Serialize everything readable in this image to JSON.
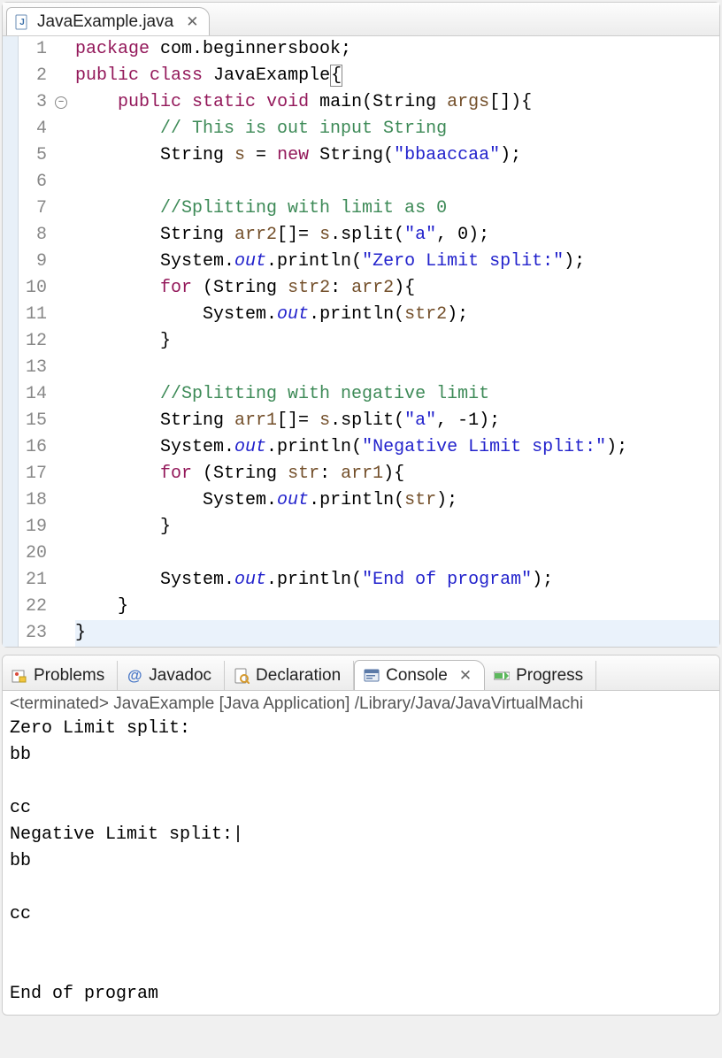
{
  "editor": {
    "tab_filename": "JavaExample.java",
    "lines": [
      {
        "n": 1,
        "html": "<span class='kw-decl'>package</span> com.beginnersbook;"
      },
      {
        "n": 2,
        "html": "<span class='kw-decl'>public</span> <span class='kw-decl'>class</span> JavaExample<span class='cursor-box'>{</span>"
      },
      {
        "n": 3,
        "html": "    <span class='kw-decl'>public</span> <span class='kw-decl'>static</span> <span class='kw-decl'>void</span> main(String <span class='var'>args</span>[]){",
        "fold": true
      },
      {
        "n": 4,
        "html": "        <span class='comment'>// This is out input String</span>"
      },
      {
        "n": 5,
        "html": "        String <span class='var'>s</span> = <span class='kw-decl'>new</span> String(<span class='str'>\"bbaaccaa\"</span>);"
      },
      {
        "n": 6,
        "html": ""
      },
      {
        "n": 7,
        "html": "        <span class='comment'>//Splitting with limit as 0</span>"
      },
      {
        "n": 8,
        "html": "        String <span class='var'>arr2</span>[]= <span class='var'>s</span>.split(<span class='str'>\"a\"</span>, 0);"
      },
      {
        "n": 9,
        "html": "        System.<span class='field-it'>out</span>.println(<span class='str'>\"Zero Limit split:\"</span>);"
      },
      {
        "n": 10,
        "html": "        <span class='kw-decl'>for</span> (String <span class='var'>str2</span>: <span class='var'>arr2</span>){"
      },
      {
        "n": 11,
        "html": "            System.<span class='field-it'>out</span>.println(<span class='var'>str2</span>);"
      },
      {
        "n": 12,
        "html": "        }"
      },
      {
        "n": 13,
        "html": ""
      },
      {
        "n": 14,
        "html": "        <span class='comment'>//Splitting with negative limit</span>"
      },
      {
        "n": 15,
        "html": "        String <span class='var'>arr1</span>[]= <span class='var'>s</span>.split(<span class='str'>\"a\"</span>, -1);"
      },
      {
        "n": 16,
        "html": "        System.<span class='field-it'>out</span>.println(<span class='str'>\"Negative Limit split:\"</span>);"
      },
      {
        "n": 17,
        "html": "        <span class='kw-decl'>for</span> (String <span class='var'>str</span>: <span class='var'>arr1</span>){"
      },
      {
        "n": 18,
        "html": "            System.<span class='field-it'>out</span>.println(<span class='var'>str</span>);"
      },
      {
        "n": 19,
        "html": "        }"
      },
      {
        "n": 20,
        "html": ""
      },
      {
        "n": 21,
        "html": "        System.<span class='field-it'>out</span>.println(<span class='str'>\"End of program\"</span>);"
      },
      {
        "n": 22,
        "html": "    }"
      },
      {
        "n": 23,
        "html": "}",
        "highlight": true
      }
    ]
  },
  "bottom_tabs": {
    "problems": "Problems",
    "javadoc": "Javadoc",
    "declaration": "Declaration",
    "console": "Console",
    "progress": "Progress"
  },
  "console": {
    "status": "<terminated> JavaExample [Java Application] /Library/Java/JavaVirtualMachi",
    "output": "Zero Limit split:\nbb\n\ncc\nNegative Limit split:|\nbb\n\ncc\n\n\nEnd of program"
  }
}
